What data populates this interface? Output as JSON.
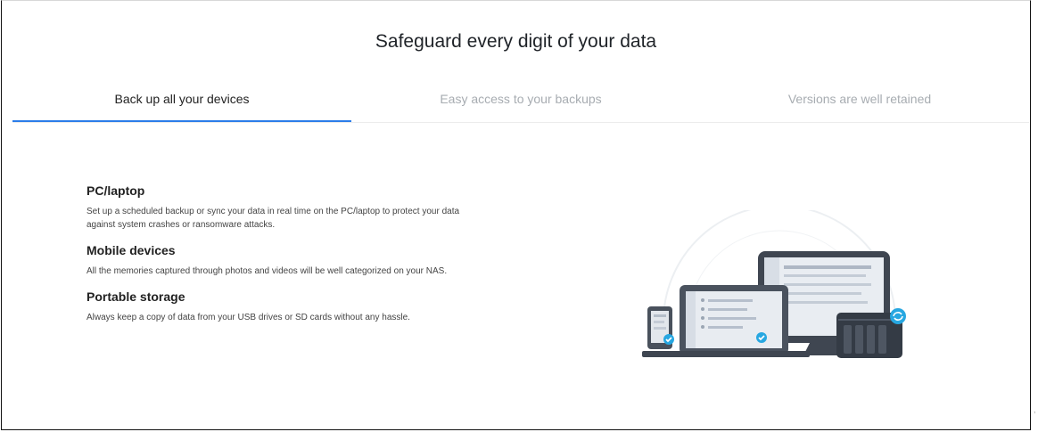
{
  "header": {
    "title": "Safeguard every digit of your data"
  },
  "tabs": [
    {
      "label": "Back up all your devices",
      "active": true
    },
    {
      "label": "Easy access to your backups",
      "active": false
    },
    {
      "label": "Versions are well retained",
      "active": false
    }
  ],
  "features": [
    {
      "title": "PC/laptop",
      "description": "Set up a scheduled backup or sync your data in real time on the PC/laptop to protect your data against system crashes or ransomware attacks."
    },
    {
      "title": "Mobile devices",
      "description": "All the memories captured through photos and videos will be well categorized on your NAS."
    },
    {
      "title": "Portable storage",
      "description": "Always keep a copy of data from your USB drives or SD cards without any hassle."
    }
  ],
  "illustration": {
    "icon": "device-backup-illustration",
    "accent_color": "#27a7e1"
  },
  "colors": {
    "active_tab_underline": "#2b7de9",
    "inactive_tab_text": "#a7acb1"
  }
}
